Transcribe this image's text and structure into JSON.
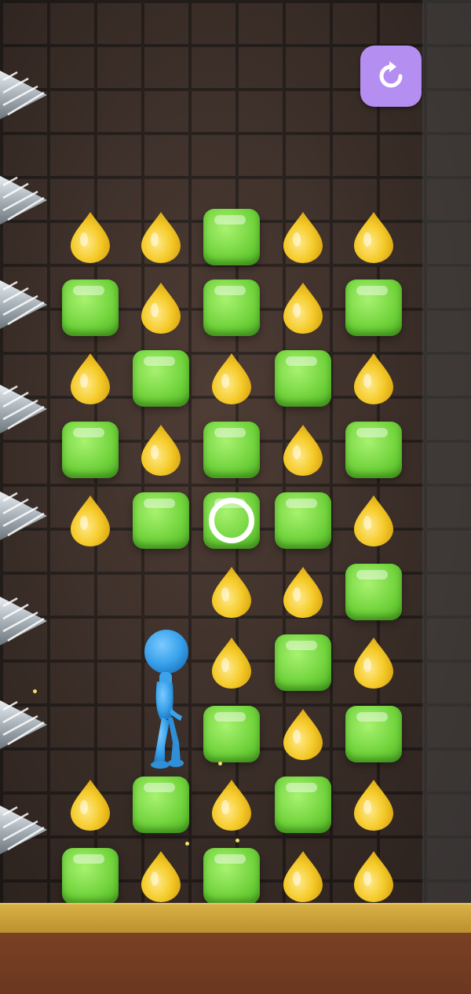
{
  "game": {
    "columns": 5,
    "rows": 10,
    "grid": [
      [
        "drop",
        "drop",
        "tile",
        "drop",
        "drop"
      ],
      [
        "tile",
        "drop",
        "tile",
        "drop",
        "tile"
      ],
      [
        "drop",
        "tile",
        "drop",
        "tile",
        "drop"
      ],
      [
        "tile",
        "drop",
        "tile",
        "drop",
        "tile"
      ],
      [
        "drop",
        "tile",
        "target",
        "tile",
        "drop"
      ],
      [
        "empty",
        "empty",
        "drop",
        "drop",
        "tile"
      ],
      [
        "empty",
        "empty",
        "drop",
        "tile",
        "drop"
      ],
      [
        "empty",
        "empty",
        "tile",
        "drop",
        "tile"
      ],
      [
        "drop",
        "tile",
        "drop",
        "tile",
        "drop"
      ],
      [
        "tile",
        "drop",
        "tile",
        "drop",
        "drop"
      ]
    ],
    "spike_count": 8,
    "player": {
      "row": 6,
      "column": 1
    },
    "selected_cell": {
      "row": 4,
      "column": 2
    }
  },
  "controls": {
    "restart_icon": "restart-icon"
  },
  "colors": {
    "tile": "#6fd23a",
    "drop": "#f2c21b",
    "player": "#3aa3ec",
    "restart_button": "#b58ef2",
    "ground": "#d8b146",
    "dirt": "#7b4024"
  }
}
